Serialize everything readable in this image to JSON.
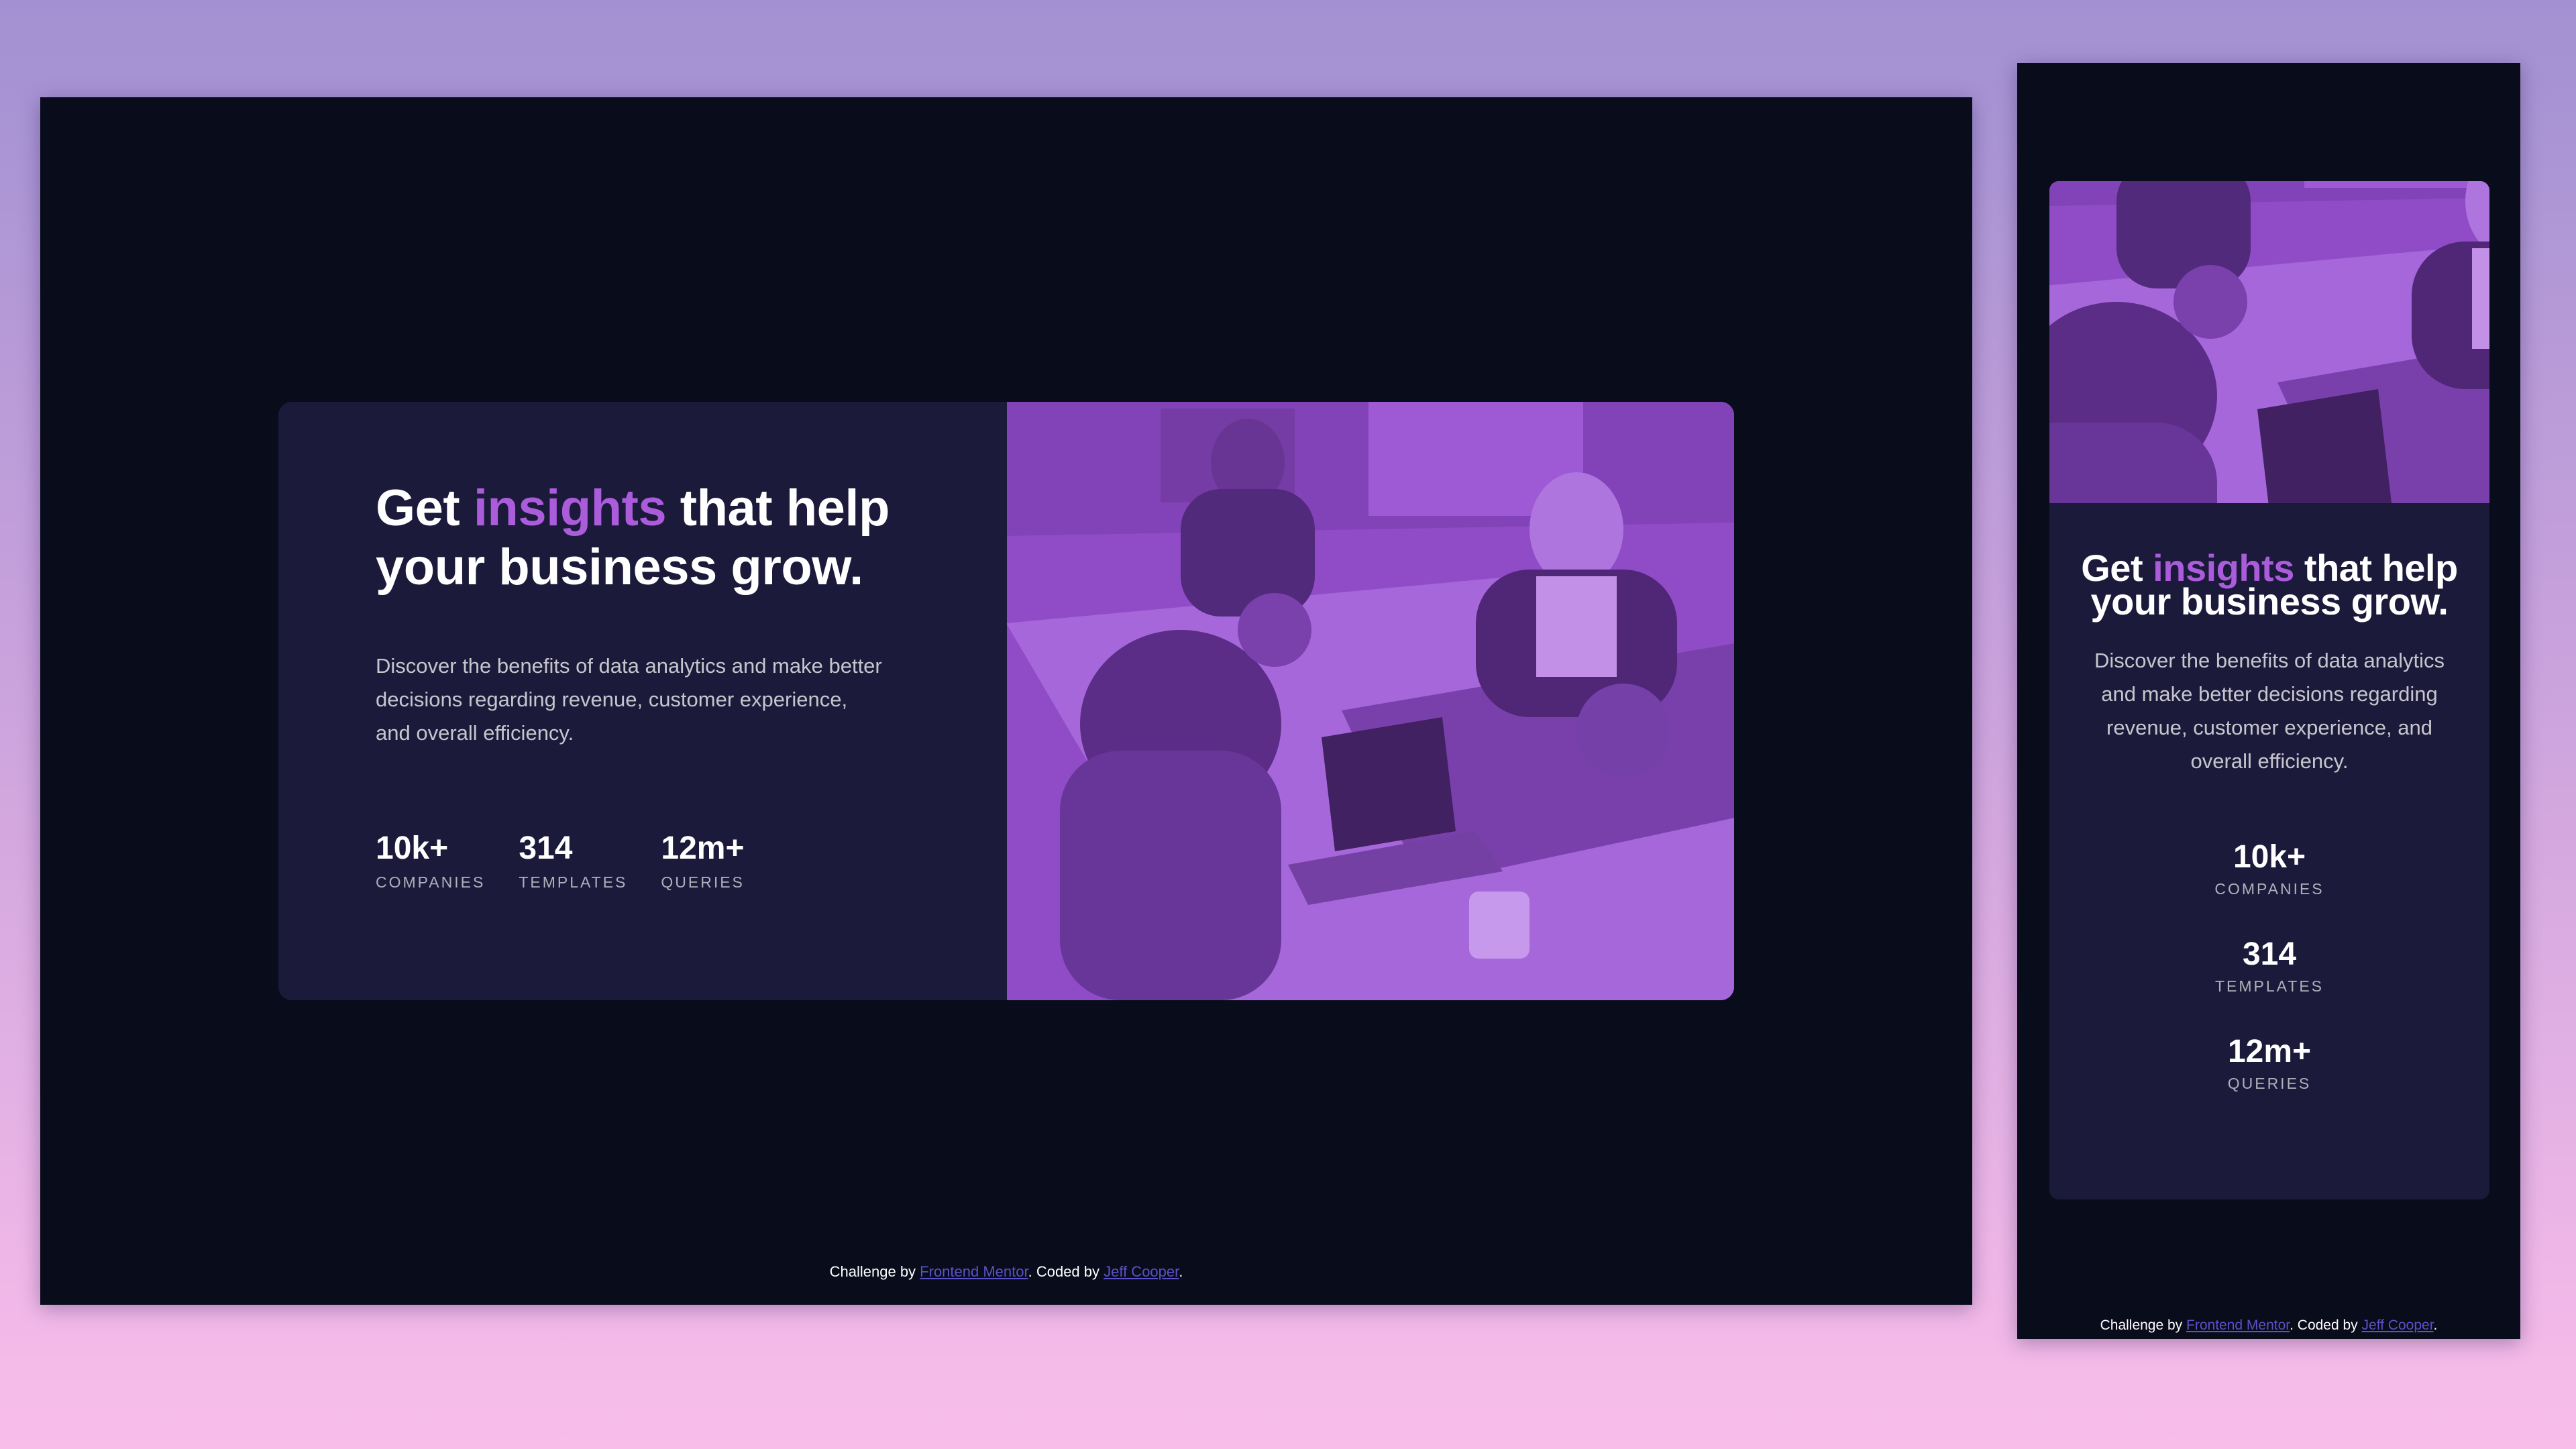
{
  "card": {
    "title_part1": "Get ",
    "title_accent": "insights",
    "title_part2": " that help your business grow.",
    "body": "Discover the benefits of data analytics and make better decisions regarding revenue, customer experience, and overall efficiency.",
    "stats": [
      {
        "value": "10k+",
        "label": "Companies"
      },
      {
        "value": "314",
        "label": "Templates"
      },
      {
        "value": "12m+",
        "label": "Queries"
      }
    ]
  },
  "attribution": {
    "prefix": "Challenge by ",
    "frontend_mentor": "Frontend Mentor",
    "middle": ". Coded by ",
    "author": "Jeff Cooper",
    "suffix": "."
  },
  "colors": {
    "page_bg": "#090c1b",
    "card_bg": "#1c1a3a",
    "accent": "#aa5cdb",
    "image_tint": "#8d4ec1"
  },
  "icons": {
    "photo": "office-meeting-photo"
  }
}
